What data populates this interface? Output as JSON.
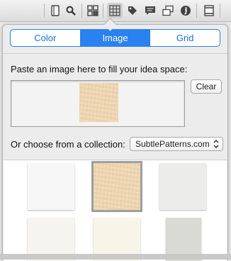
{
  "toolbar": {
    "icons": [
      "document-icon",
      "search-icon",
      "grid-view-icon",
      "table-grid-icon",
      "tag-icon",
      "comment-icon",
      "windows-icon",
      "info-icon",
      "inspector-icon"
    ]
  },
  "popover": {
    "tabs": [
      {
        "label": "Color",
        "active": false
      },
      {
        "label": "Image",
        "active": true
      },
      {
        "label": "Grid",
        "active": false
      }
    ],
    "paste_label": "Paste an image here to fill your idea space:",
    "clear_label": "Clear",
    "collection_label": "Or choose from a collection:",
    "collection_value": "SubtlePatterns.com"
  },
  "patterns": [
    {
      "name": "white-paper",
      "color": "#f7f7f7",
      "selected": false
    },
    {
      "name": "light-wood",
      "color": "#f0d8b4",
      "selected": true
    },
    {
      "name": "light-grey-linen",
      "color": "#ececea",
      "selected": false
    },
    {
      "name": "off-white-texture",
      "color": "#f6f4f1",
      "selected": false
    },
    {
      "name": "cream-paper",
      "color": "#f6f5e8",
      "selected": false
    },
    {
      "name": "grey-stone",
      "color": "#d9d9d6",
      "selected": false
    }
  ],
  "colors": {
    "accent": "#2a82f0",
    "accent_text": "#1a6fe0"
  }
}
